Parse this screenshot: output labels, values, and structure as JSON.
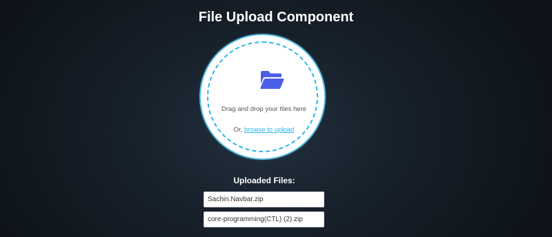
{
  "page": {
    "title": "File Upload Component"
  },
  "dropzone": {
    "icon": "folder-open-icon",
    "instruction": "Drag and drop your files here",
    "browse_prefix": "Or, ",
    "browse_link": "browse to upload"
  },
  "uploaded": {
    "heading": "Uploaded Files:",
    "files": [
      "Sachin.Navbar.zip",
      "core-programming(CTL) (2).zip"
    ]
  },
  "colors": {
    "accent": "#2ab4e8",
    "folder": "#4a5ee8",
    "background": "#17212b"
  }
}
